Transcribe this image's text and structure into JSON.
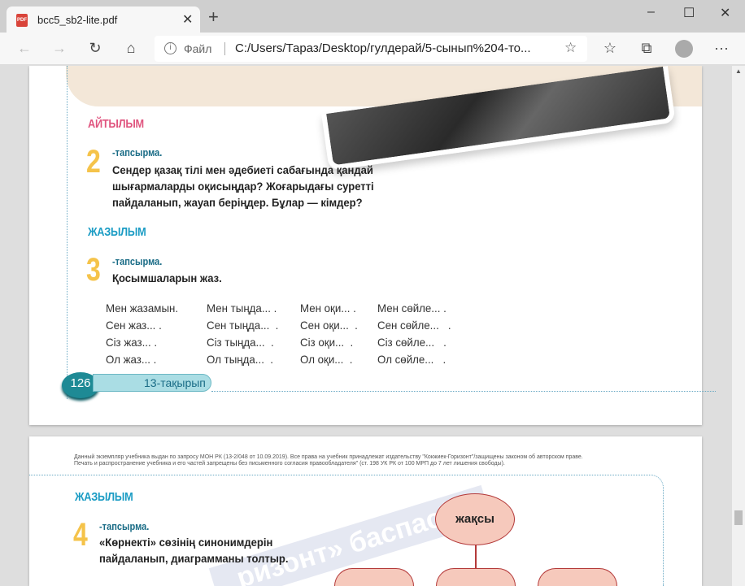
{
  "browser": {
    "tab_title": "bcc5_sb2-lite.pdf",
    "new_tab": "+",
    "address_label": "Файл",
    "url": "C:/Users/Тараз/Desktop/гулдерай/5-сынып%204-то...",
    "minimize": "–",
    "maximize": "☐",
    "close": "✕",
    "more": "···"
  },
  "page1": {
    "section_speaking": "АЙТЫЛЫМ",
    "task2": {
      "number": "2",
      "label": "-тапсырма.",
      "lines": [
        "Сендер қазақ тілі мен әдебиеті сабағында қандай",
        "шығармаларды оқисыңдар? Жоғарыдағы суретті",
        "пайдаланып, жауап беріңдер. Бұлар — кімдер?"
      ]
    },
    "section_writing": "ЖАЗЫЛЫМ",
    "task3": {
      "number": "3",
      "label": "-тапсырма.",
      "text": "Қосымшаларын жаз."
    },
    "table": [
      [
        "Мен жазамын.",
        "Мен тыңда... .",
        "Мен оқи... .",
        "Мен сөйле... ."
      ],
      [
        "Сен жаз... .",
        "Сен тыңда...  .",
        "Сен оқи...  .",
        "Сен сөйле...   ."
      ],
      [
        "Сіз жаз... .",
        "Сіз тыңда...  .",
        "Сіз оқи...  .",
        "Сіз сөйле...   ."
      ],
      [
        "Ол жаз... .",
        "Ол тыңда...  .",
        "Ол оқи...  .",
        "Ол сөйле...   ."
      ]
    ],
    "page_number": "126",
    "topic": "13-тақырып"
  },
  "page2": {
    "legal": [
      "Данный экземпляр учебника выдан по запросу МОН РК (13-2/048 от 10.09.2019). Все права на учебник принадлежат издательству \"Кокжиек-Горизонт\"/защищены законом об авторском праве.",
      "Печать и распространение учебника и его частей запрещены без письменного согласия правообладателя\" (ст. 198 УК РК от 100 МРП до 7 лет лишения свободы)."
    ],
    "section_writing": "ЖАЗЫЛЫМ",
    "task4": {
      "number": "4",
      "label": "-тапсырма.",
      "lines": [
        "«Көрнекті» сөзінің синонимдерін",
        "пайдаланып, диаграмманы толтыр."
      ]
    },
    "diagram_center": "жақсы",
    "watermark": "ризонт» баспасы"
  },
  "colors": {
    "speaking": "#e0557f",
    "writing": "#1b9cc4",
    "number": "#f5c34a"
  }
}
